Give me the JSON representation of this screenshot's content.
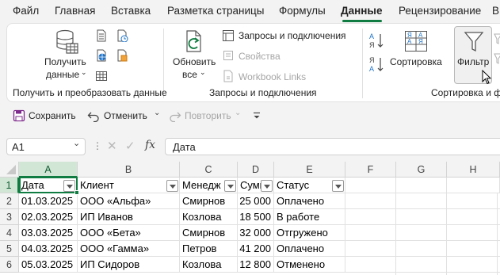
{
  "tabs": [
    {
      "label": "Файл"
    },
    {
      "label": "Главная"
    },
    {
      "label": "Вставка"
    },
    {
      "label": "Разметка страницы"
    },
    {
      "label": "Формулы"
    },
    {
      "label": "Данные"
    },
    {
      "label": "Рецензирование"
    },
    {
      "label": "В"
    }
  ],
  "active_tab": "Данные",
  "ribbon": {
    "get_data": {
      "line1": "Получить",
      "line2": "данные"
    },
    "refresh_all": {
      "line1": "Обновить",
      "line2": "все"
    },
    "queries_connections": "Запросы и подключения",
    "properties": "Свойства",
    "workbook_links": "Workbook Links",
    "sort": "Сортировка",
    "filter": "Фильтр",
    "groups": {
      "get_transform": "Получить и преобразовать данные",
      "queries": "Запросы и подключения",
      "sort_filter": "Сортировка и ф"
    }
  },
  "qat": {
    "save": "Сохранить",
    "undo": "Отменить",
    "redo": "Повторить"
  },
  "formula_bar": {
    "name_box": "A1",
    "fx": "fx",
    "content": "Дата"
  },
  "columns": [
    "A",
    "B",
    "C",
    "D",
    "E",
    "F",
    "G",
    "H"
  ],
  "rows": [
    "1",
    "2",
    "3",
    "4",
    "5",
    "6"
  ],
  "table": {
    "headers": [
      "Дата",
      "Клиент",
      "Менедж",
      "Сумм",
      "Статус"
    ],
    "data": [
      [
        "01.03.2025",
        "ООО «Альфа»",
        "Смирнов",
        "25 000",
        "Оплачено"
      ],
      [
        "02.03.2025",
        "ИП Иванов",
        "Козлова",
        "18 500",
        "В работе"
      ],
      [
        "03.03.2025",
        "ООО «Бета»",
        "Смирнов",
        "32 000",
        "Отгружено"
      ],
      [
        "04.03.2025",
        "ООО «Гамма»",
        "Петров",
        "41 200",
        "Оплачено"
      ],
      [
        "05.03.2025",
        "ИП Сидоров",
        "Козлова",
        "12 800",
        "Отменено"
      ]
    ]
  },
  "colors": {
    "accent": "#107c41",
    "selected_header": "#d2e6d6"
  }
}
